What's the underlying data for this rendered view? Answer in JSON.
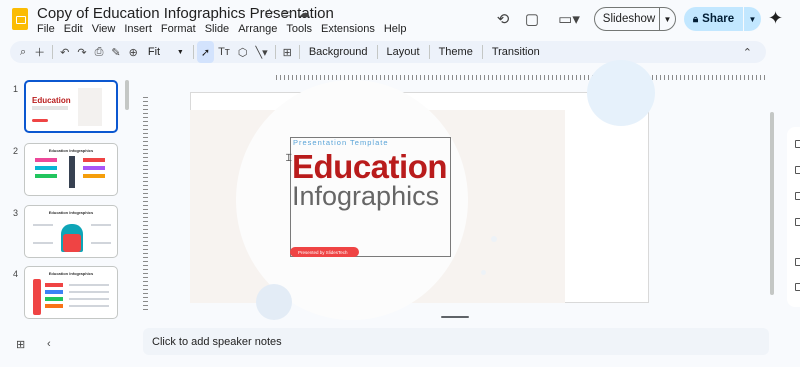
{
  "app": {
    "title": "Copy of Education Infographics Presentation",
    "star_icon": "star-icon",
    "move_icon": "folder-icon",
    "cloud_icon": "cloud-icon"
  },
  "menu": [
    "File",
    "Edit",
    "View",
    "Insert",
    "Format",
    "Slide",
    "Arrange",
    "Tools",
    "Extensions",
    "Help"
  ],
  "header": {
    "slideshow_label": "Slideshow",
    "share_label": "Share"
  },
  "toolbar": {
    "zoom_label": "Fit",
    "background_label": "Background",
    "layout_label": "Layout",
    "theme_label": "Theme",
    "transition_label": "Transition"
  },
  "filmstrip": {
    "slides": [
      {
        "number": "1",
        "title": "Education"
      },
      {
        "number": "2",
        "title": "Education Infographics"
      },
      {
        "number": "3",
        "title": "Education Infographics"
      },
      {
        "number": "4",
        "title": "Education Infographics"
      }
    ]
  },
  "slide": {
    "kicker": "Presentation Template",
    "title": "Education",
    "subtitle": "Infographics",
    "presented_by": "Presented by SlidesTech"
  },
  "notes": {
    "placeholder": "Click to add speaker notes"
  },
  "colors": {
    "accent": "#0b57d0",
    "share_bg": "#c2e7ff",
    "title_red": "#b91c1c",
    "logo_yellow": "#fbbc04"
  }
}
